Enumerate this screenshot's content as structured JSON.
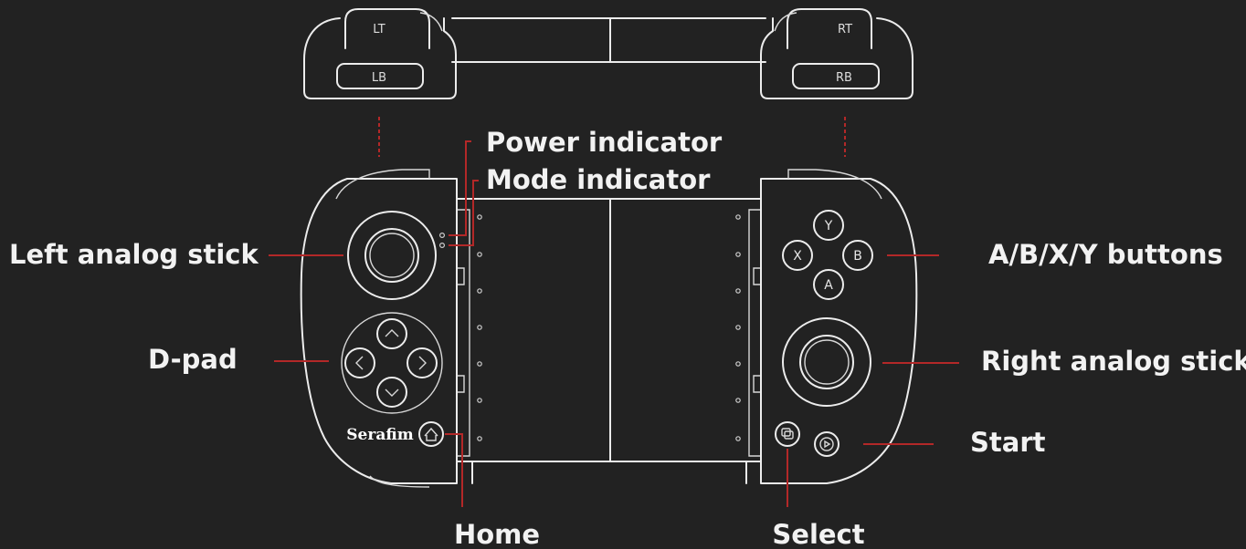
{
  "top_view": {
    "left_trigger": "LT",
    "left_bumper": "LB",
    "right_trigger": "RT",
    "right_bumper": "RB"
  },
  "brand": "Serafim",
  "buttons": {
    "y": "Y",
    "x": "X",
    "b": "B",
    "a": "A"
  },
  "callouts": {
    "power_indicator": "Power indicator",
    "mode_indicator": "Mode indicator",
    "left_analog_stick": "Left analog stick",
    "dpad": "D-pad",
    "abxy_buttons": "A/B/X/Y buttons",
    "right_analog_stick": "Right analog stick",
    "start": "Start",
    "home": "Home",
    "select": "Select"
  },
  "colors": {
    "background": "#222222",
    "outline": "#ececec",
    "leader_line": "#b32828",
    "label_text": "#f2f2f2"
  }
}
